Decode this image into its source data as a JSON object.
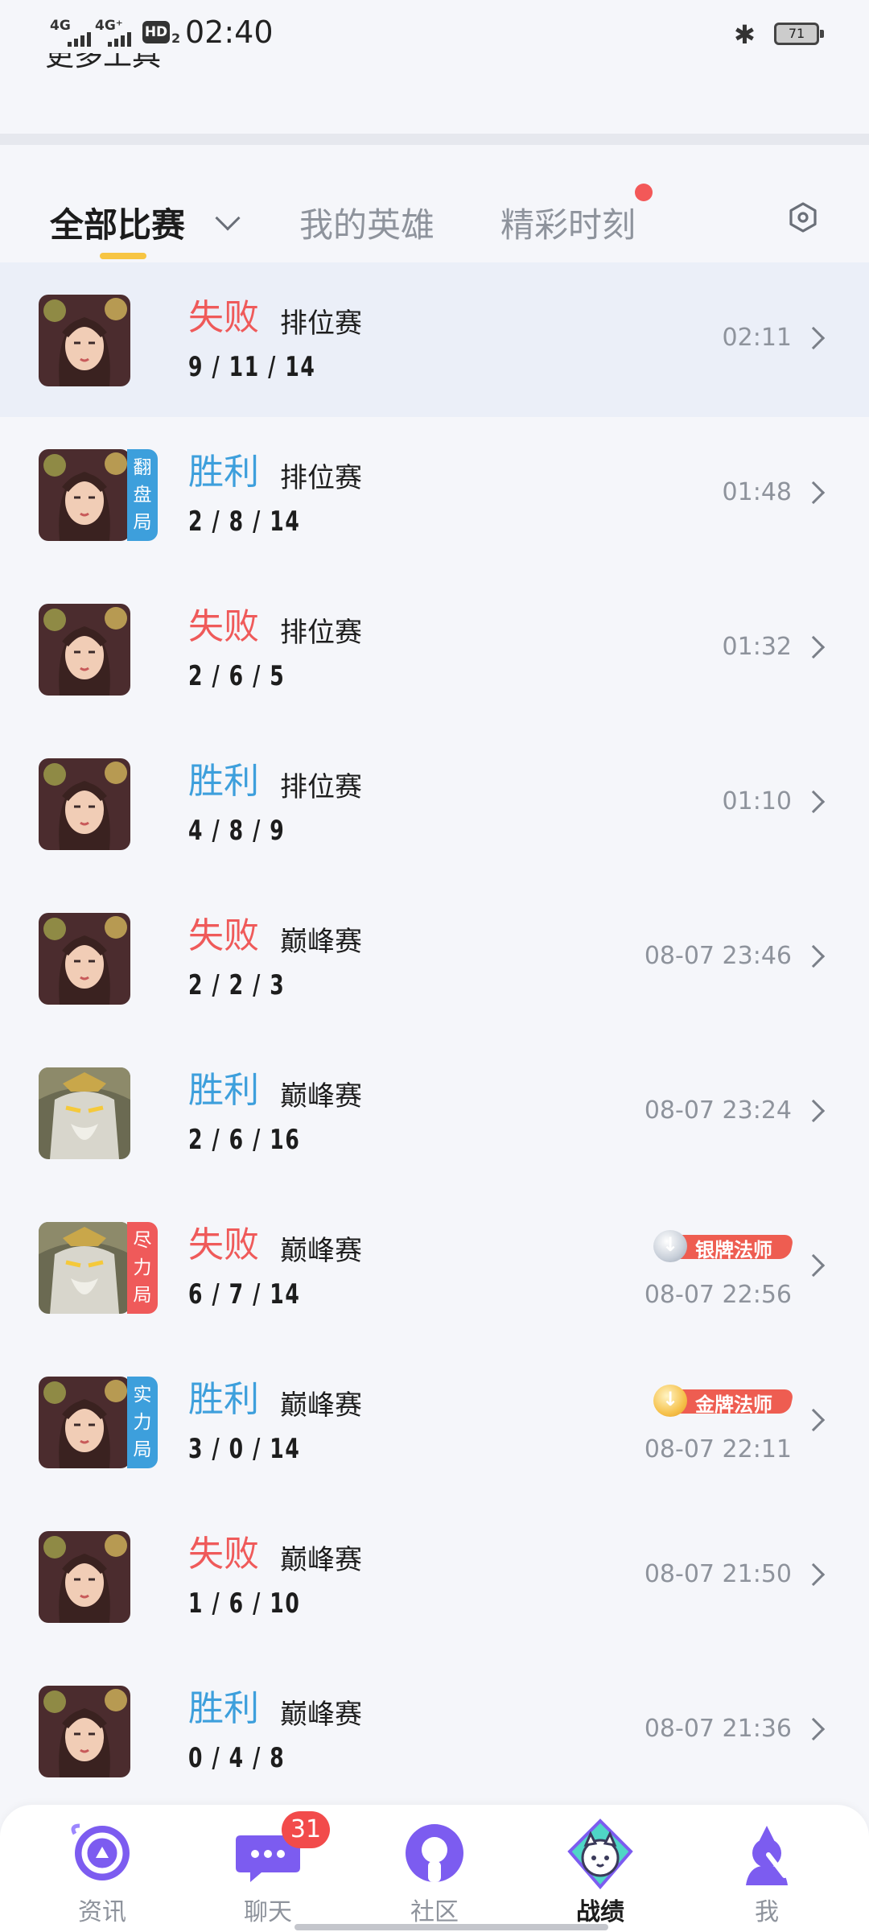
{
  "status_bar": {
    "signal1": "4G",
    "signal2": "4G⁺",
    "hd": "HD",
    "hd_sub": "2",
    "time": "02:40",
    "bluetooth_icon": "bluetooth-icon",
    "battery": "71"
  },
  "header": {
    "more_tools": "更多工具"
  },
  "tabs": {
    "all_matches": "全部比赛",
    "my_heroes": "我的英雄",
    "highlights": "精彩时刻"
  },
  "matches": [
    {
      "result": "失败",
      "mode": "排位赛",
      "kda": "9 / 11 / 14",
      "time": "02:11"
    },
    {
      "result": "胜利",
      "mode": "排位赛",
      "kda": "2 / 8 / 14",
      "time": "01:48",
      "badge": "翻盘局"
    },
    {
      "result": "失败",
      "mode": "排位赛",
      "kda": "2 / 6 / 5",
      "time": "01:32"
    },
    {
      "result": "胜利",
      "mode": "排位赛",
      "kda": "4 / 8 / 9",
      "time": "01:10"
    },
    {
      "result": "失败",
      "mode": "巅峰赛",
      "kda": "2 / 2 / 3",
      "time": "08-07 23:46"
    },
    {
      "result": "胜利",
      "mode": "巅峰赛",
      "kda": "2 / 6 / 16",
      "time": "08-07 23:24"
    },
    {
      "result": "失败",
      "mode": "巅峰赛",
      "kda": "6 / 7 / 14",
      "time": "08-07 22:56",
      "badge": "尽力局",
      "rank": "银牌法师"
    },
    {
      "result": "胜利",
      "mode": "巅峰赛",
      "kda": "3 / 0 / 14",
      "time": "08-07 22:11",
      "badge": "实力局",
      "rank": "金牌法师"
    },
    {
      "result": "失败",
      "mode": "巅峰赛",
      "kda": "1 / 6 / 10",
      "time": "08-07 21:50"
    },
    {
      "result": "胜利",
      "mode": "巅峰赛",
      "kda": "0 / 4 / 8",
      "time": "08-07 21:36"
    }
  ],
  "bottom_nav": {
    "news": "资讯",
    "chat": "聊天",
    "chat_badge": "31",
    "community": "社区",
    "record": "战绩",
    "me": "我"
  },
  "colors": {
    "lose": "#ef5a5a",
    "win": "#3d9fdc",
    "comeback_badge": "#3d9fdc",
    "effort_badge": "#ef5a5a",
    "strength_badge": "#3d9fdc",
    "tab_underline": "#f7c543",
    "nav_purple": "#7c5cf0",
    "notification": "#f24b4b"
  }
}
